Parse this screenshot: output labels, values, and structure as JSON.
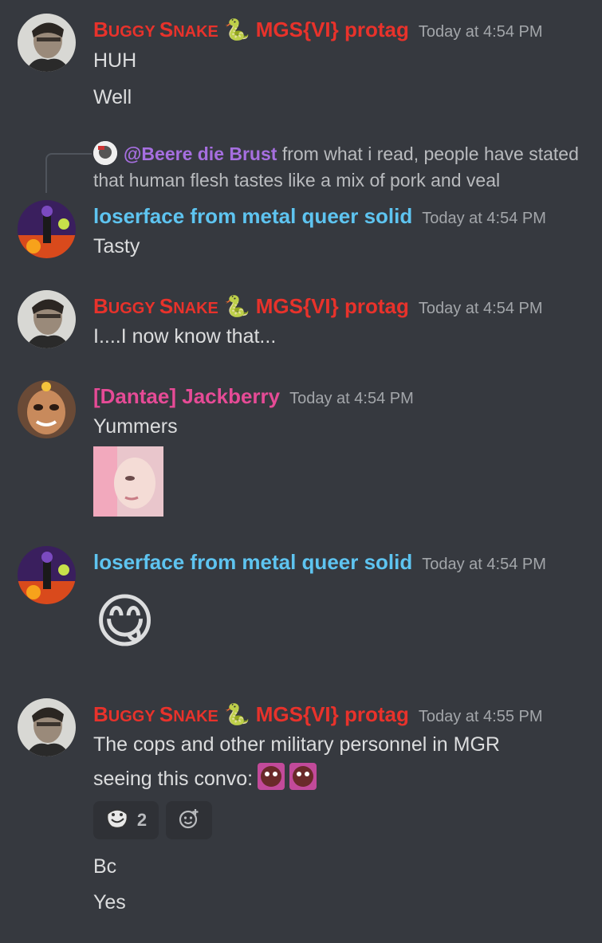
{
  "users": {
    "snake": {
      "name_first": "B",
      "name_rest1": "UGGY ",
      "name_s": "S",
      "name_rest2": "NAKE",
      "emoji": "🐍",
      "tag": "MGS{VI} protag"
    },
    "loser": {
      "name": "loserface from metal queer solid"
    },
    "dantae": {
      "name": "[Dantae] Jackberry"
    }
  },
  "messages": [
    {
      "user": "snake",
      "time": "Today at 4:54 PM",
      "lines": [
        "HUH",
        "Well"
      ]
    },
    {
      "user": "loser",
      "time": "Today at 4:54 PM",
      "reply": {
        "author": "@Beere die Brust",
        "text": "from what i read, people have stated that human flesh tastes like a mix of pork and veal"
      },
      "lines": [
        "Tasty"
      ]
    },
    {
      "user": "snake",
      "time": "Today at 4:54 PM",
      "lines": [
        "I....I now know that..."
      ]
    },
    {
      "user": "dantae",
      "time": "Today at 4:54 PM",
      "lines": [
        "Yummers"
      ],
      "attachment": "sticker-image"
    },
    {
      "user": "loser",
      "time": "Today at 4:54 PM",
      "emoji": "😋"
    },
    {
      "user": "snake",
      "time": "Today at 4:55 PM",
      "lines": [
        "The cops and other military personnel in MGR",
        "seeing this convo:",
        "Bc",
        "Yes"
      ],
      "reactions": [
        {
          "icon": "troll-face-icon",
          "count": "2"
        }
      ]
    }
  ],
  "colors": {
    "background": "#36393f",
    "snake": "#e8322b",
    "loser": "#5ec4f0",
    "dantae": "#e64b96",
    "reply_author": "#a66fe0",
    "timestamp": "#a3a6aa"
  }
}
